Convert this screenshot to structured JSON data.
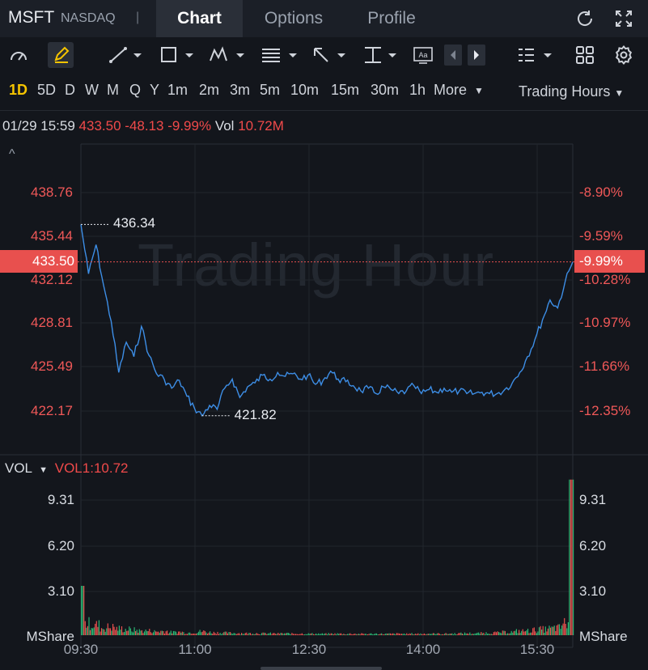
{
  "header": {
    "ticker": "MSFT",
    "exchange": "NASDAQ",
    "separator": "|",
    "tabs": [
      {
        "label": "Chart",
        "active": true
      },
      {
        "label": "Options",
        "active": false
      },
      {
        "label": "Profile",
        "active": false
      }
    ],
    "icons": [
      "refresh-icon",
      "fullscreen-icon"
    ]
  },
  "toolbar": {
    "icons": [
      "gauge-icon",
      "pen-icon",
      "trend-line-icon",
      "rectangle-icon",
      "pattern-icon",
      "fibonacci-icon",
      "arrow-icon",
      "measure-icon",
      "text-label-icon",
      "prev-icon",
      "next-icon",
      "list-icon",
      "layout-grid-icon",
      "settings-gear-icon"
    ]
  },
  "timeframes": {
    "items": [
      "1D",
      "5D",
      "D",
      "W",
      "M",
      "Q",
      "Y",
      "1m",
      "2m",
      "3m",
      "5m",
      "10m",
      "15m",
      "30m",
      "1h",
      "More"
    ],
    "active": "1D",
    "more_caret": "▼",
    "trading_hours": "Trading Hours",
    "trading_hours_caret": "▼"
  },
  "info": {
    "datetime": "01/29 15:59",
    "price": "433.50",
    "change": "-48.13",
    "change_pct": "-9.99%",
    "vol_label": "Vol",
    "vol_value": "10.72M"
  },
  "price_axis": {
    "left_labels": [
      "438.76",
      "435.44",
      "432.12",
      "428.81",
      "425.49",
      "422.17"
    ],
    "right_labels": [
      "-8.90%",
      "-9.59%",
      "-10.28%",
      "-10.97%",
      "-11.66%",
      "-12.35%"
    ],
    "current_price": "433.50",
    "current_pct": "-9.99%",
    "high_callout": "436.34",
    "low_callout": "421.82",
    "collapse_caret": "^",
    "watermark": "Trading Hour"
  },
  "volume": {
    "label": "VOL",
    "caret": "▼",
    "indicator": "VOL1:10.72",
    "left_labels": [
      "9.31",
      "6.20",
      "3.10",
      "MShare"
    ],
    "right_labels": [
      "9.31",
      "6.20",
      "3.10",
      "MShare"
    ]
  },
  "time_axis": [
    "09:30",
    "11:00",
    "12:30",
    "14:00",
    "15:30"
  ],
  "colors": {
    "background": "#13161c",
    "header": "#1b1f27",
    "active_tab": "#2a2f38",
    "line": "#3d8ee6",
    "negative": "#f04a4a",
    "positive_volume": "#2bb673",
    "active_timeframe": "#f5c400"
  },
  "chart_data": {
    "type": "line",
    "x_label": "",
    "y_label": "",
    "ylim": [
      420.5,
      441.0
    ],
    "x_ticks": [
      "09:30",
      "11:00",
      "12:30",
      "14:00",
      "15:30"
    ],
    "x": [
      "09:30",
      "09:36",
      "09:42",
      "09:48",
      "09:54",
      "10:00",
      "10:06",
      "10:12",
      "10:18",
      "10:24",
      "10:30",
      "10:36",
      "10:42",
      "10:48",
      "10:54",
      "11:00",
      "11:06",
      "11:12",
      "11:18",
      "11:24",
      "11:30",
      "11:36",
      "11:42",
      "11:48",
      "11:54",
      "12:00",
      "12:06",
      "12:12",
      "12:18",
      "12:24",
      "12:30",
      "12:36",
      "12:42",
      "12:48",
      "12:54",
      "13:00",
      "13:06",
      "13:12",
      "13:18",
      "13:24",
      "13:30",
      "13:36",
      "13:42",
      "13:48",
      "13:54",
      "14:00",
      "14:06",
      "14:12",
      "14:18",
      "14:24",
      "14:30",
      "14:36",
      "14:42",
      "14:48",
      "14:54",
      "15:00",
      "15:06",
      "15:12",
      "15:18",
      "15:24",
      "15:30",
      "15:36",
      "15:42",
      "15:48",
      "15:54",
      "15:59"
    ],
    "series": [
      {
        "values": [
          436.34,
          432.6,
          434.8,
          431.7,
          429.0,
          425.1,
          427.4,
          426.3,
          428.6,
          426.4,
          425.0,
          424.6,
          423.9,
          424.5,
          423.3,
          422.4,
          421.82,
          422.6,
          422.3,
          423.9,
          424.6,
          423.2,
          424.0,
          424.3,
          424.9,
          424.6,
          425.1,
          424.8,
          425.0,
          424.6,
          424.9,
          424.2,
          424.5,
          425.2,
          424.6,
          424.4,
          424.1,
          423.7,
          423.9,
          423.5,
          424.0,
          423.8,
          423.5,
          423.7,
          424.1,
          423.5,
          423.8,
          423.6,
          423.9,
          423.6,
          423.7,
          423.5,
          423.5,
          423.6,
          423.5,
          423.5,
          423.8,
          424.3,
          425.1,
          426.3,
          427.6,
          429.1,
          430.6,
          430.0,
          432.0,
          433.5
        ],
        "high": 436.34,
        "low": 421.82,
        "last": 433.5
      }
    ],
    "volume_series": {
      "unit": "MShare",
      "ylim": [
        0,
        12.4
      ],
      "values": [
        3.4,
        0.8,
        0.7,
        0.5,
        0.55,
        0.45,
        0.4,
        0.35,
        0.3,
        0.3,
        0.25,
        0.28,
        0.2,
        0.22,
        0.18,
        0.2,
        0.25,
        0.2,
        0.18,
        0.16,
        0.15,
        0.14,
        0.13,
        0.14,
        0.12,
        0.12,
        0.11,
        0.12,
        0.1,
        0.11,
        0.1,
        0.1,
        0.09,
        0.1,
        0.1,
        0.09,
        0.1,
        0.09,
        0.09,
        0.1,
        0.09,
        0.09,
        0.1,
        0.09,
        0.1,
        0.1,
        0.11,
        0.1,
        0.1,
        0.11,
        0.12,
        0.13,
        0.12,
        0.14,
        0.16,
        0.17,
        0.2,
        0.22,
        0.28,
        0.3,
        0.35,
        0.4,
        0.45,
        0.5,
        0.8,
        10.72
      ],
      "last": 10.72
    }
  }
}
